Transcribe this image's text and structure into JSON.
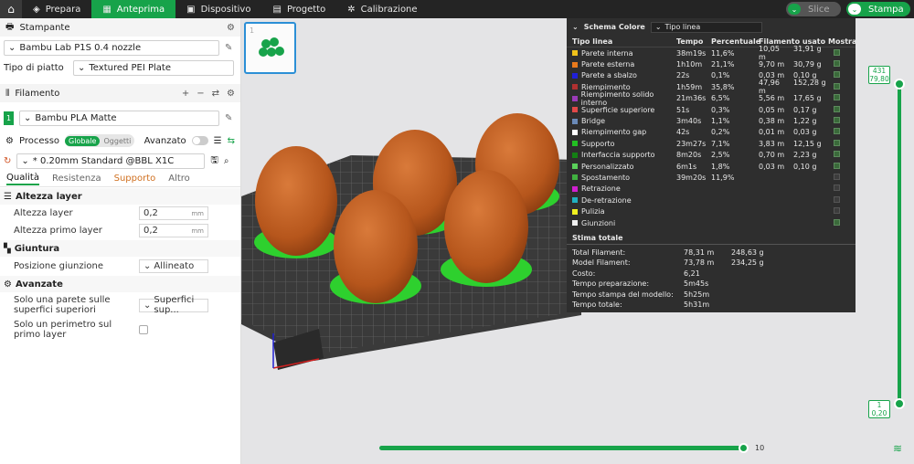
{
  "topbar": {
    "tabs": [
      {
        "label": "Prepara"
      },
      {
        "label": "Anteprima"
      },
      {
        "label": "Dispositivo"
      },
      {
        "label": "Progetto"
      },
      {
        "label": "Calibrazione"
      }
    ],
    "slice": "Slice",
    "stampa": "Stampa"
  },
  "printer": {
    "section": "Stampante",
    "name": "Bambu Lab P1S 0.4 nozzle",
    "plate_label": "Tipo di piatto",
    "plate_value": "Textured PEI Plate"
  },
  "filament": {
    "section": "Filamento",
    "index": "1",
    "name": "Bambu PLA Matte"
  },
  "process": {
    "section": "Processo",
    "globale": "Globale",
    "oggetti": "Oggetti",
    "avanzato": "Avanzato",
    "profile": "* 0.20mm Standard @BBL X1C",
    "tabs": [
      "Qualità",
      "Resistenza",
      "Supporto",
      "Altro"
    ],
    "groups": {
      "altezza": "Altezza layer",
      "giuntura": "Giuntura",
      "avanzate": "Avanzate"
    },
    "rows": {
      "altezza_layer": {
        "label": "Altezza layer",
        "value": "0,2",
        "unit": "mm"
      },
      "altezza_primo": {
        "label": "Altezza primo layer",
        "value": "0,2",
        "unit": "mm"
      },
      "pos_giunzione": {
        "label": "Posizione giunzione",
        "value": "Allineato"
      },
      "una_parete": {
        "label": "Solo una parete sulle superfici superiori",
        "value": "Superfici sup..."
      },
      "un_perimetro": {
        "label": "Solo un perimetro sul primo layer"
      }
    }
  },
  "thumbnail": {
    "number": "1"
  },
  "legend": {
    "title": "Schema Colore",
    "mode": "Tipo linea",
    "cols": [
      "Tipo linea",
      "Tempo",
      "Percentuale",
      "Filamento usato",
      "Mostra"
    ],
    "rows": [
      {
        "name": "Parete interna",
        "color": "#f0c21a",
        "time": "38m19s",
        "pct": "11,6%",
        "fm": "10,05 m",
        "fg": "31,91 g",
        "show": true
      },
      {
        "name": "Parete esterna",
        "color": "#e87a1c",
        "time": "1h10m",
        "pct": "21,1%",
        "fm": "9,70 m",
        "fg": "30,79 g",
        "show": true
      },
      {
        "name": "Parete a sbalzo",
        "color": "#2020d8",
        "time": "22s",
        "pct": "0,1%",
        "fm": "0,03 m",
        "fg": "0,10 g",
        "show": true
      },
      {
        "name": "Riempimento",
        "color": "#b03030",
        "time": "1h59m",
        "pct": "35,8%",
        "fm": "47,96 m",
        "fg": "152,28 g",
        "show": true
      },
      {
        "name": "Riempimento solido interno",
        "color": "#9a3bb8",
        "time": "21m36s",
        "pct": "6,5%",
        "fm": "5,56 m",
        "fg": "17,65 g",
        "show": true
      },
      {
        "name": "Superficie superiore",
        "color": "#e04848",
        "time": "51s",
        "pct": "0,3%",
        "fm": "0,05 m",
        "fg": "0,17 g",
        "show": true
      },
      {
        "name": "Bridge",
        "color": "#6a8ab8",
        "time": "3m40s",
        "pct": "1,1%",
        "fm": "0,38 m",
        "fg": "1,22 g",
        "show": true
      },
      {
        "name": "Riempimento gap",
        "color": "#ffffff",
        "time": "42s",
        "pct": "0,2%",
        "fm": "0,01 m",
        "fg": "0,03 g",
        "show": true
      },
      {
        "name": "Supporto",
        "color": "#22c022",
        "time": "23m27s",
        "pct": "7,1%",
        "fm": "3,83 m",
        "fg": "12,15 g",
        "show": true
      },
      {
        "name": "Interfaccia supporto",
        "color": "#138013",
        "time": "8m20s",
        "pct": "2,5%",
        "fm": "0,70 m",
        "fg": "2,23 g",
        "show": true
      },
      {
        "name": "Personalizzato",
        "color": "#5ad05a",
        "time": "6m1s",
        "pct": "1,8%",
        "fm": "0,03 m",
        "fg": "0,10 g",
        "show": true
      },
      {
        "name": "Spostamento",
        "color": "#40b040",
        "time": "39m20s",
        "pct": "11,9%",
        "fm": "",
        "fg": "",
        "show": false
      },
      {
        "name": "Retrazione",
        "color": "#d020d0",
        "time": "",
        "pct": "",
        "fm": "",
        "fg": "",
        "show": false
      },
      {
        "name": "De-retrazione",
        "color": "#20b0c0",
        "time": "",
        "pct": "",
        "fm": "",
        "fg": "",
        "show": false
      },
      {
        "name": "Pulizia",
        "color": "#f0f020",
        "time": "",
        "pct": "",
        "fm": "",
        "fg": "",
        "show": false
      },
      {
        "name": "Giunzioni",
        "color": "#f0f0f0",
        "time": "",
        "pct": "",
        "fm": "",
        "fg": "",
        "show": true
      }
    ],
    "totals_title": "Stima totale",
    "totals": [
      {
        "label": "Total Filament:",
        "a": "78,31 m",
        "b": "248,63 g"
      },
      {
        "label": "Model Filament:",
        "a": "73,78 m",
        "b": "234,25 g"
      },
      {
        "label": "Costo:",
        "a": "6,21",
        "b": ""
      },
      {
        "label": "Tempo preparazione:",
        "a": "5m45s",
        "b": ""
      },
      {
        "label": "Tempo stampa del modello:",
        "a": "5h25m",
        "b": ""
      },
      {
        "label": "Tempo totale:",
        "a": "5h31m",
        "b": ""
      }
    ]
  },
  "layer_slider": {
    "top": "431",
    "top_h": "79,80",
    "bottom": "1",
    "bottom_h": "0,20"
  },
  "move_slider": {
    "value": "10"
  }
}
